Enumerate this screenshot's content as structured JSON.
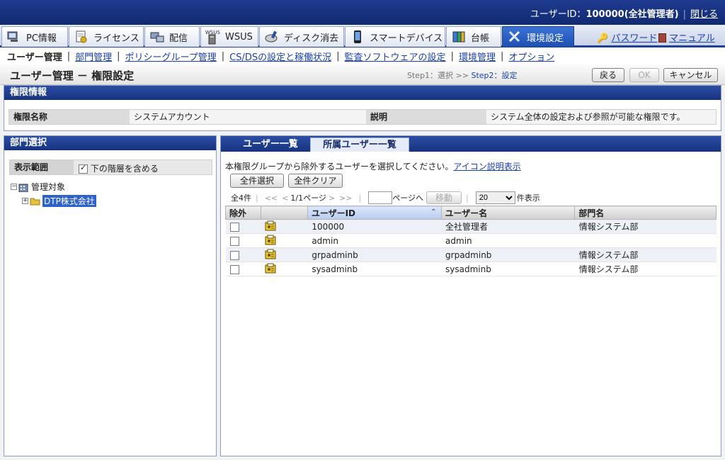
{
  "header": {
    "user_id_label": "ユーザーID：",
    "user_id_value": "100000(全社管理者)",
    "close_label": "閉じる"
  },
  "main_tabs": [
    {
      "label": "PC情報",
      "icon": "pc-icon"
    },
    {
      "label": "ライセンス",
      "icon": "license-icon"
    },
    {
      "label": "配信",
      "icon": "distribution-icon"
    },
    {
      "label": "WSUS",
      "icon": "wsus-icon"
    },
    {
      "label": "ディスク消去",
      "icon": "disk-erase-icon"
    },
    {
      "label": "スマートデバイス",
      "icon": "smart-device-icon"
    },
    {
      "label": "台帳",
      "icon": "ledger-icon"
    },
    {
      "label": "環境設定",
      "icon": "settings-tools-icon",
      "active": true
    }
  ],
  "right_links": {
    "password": "パスワード",
    "manual": "マニュアル"
  },
  "subnav": {
    "current": "ユーザー管理",
    "items": [
      "部門管理",
      "ポリシーグループ管理",
      "CS/DSの設定と稼働状況",
      "監査ソフトウェアの設定",
      "環境管理",
      "オプション"
    ]
  },
  "page": {
    "title": "ユーザー管理 － 権限設定",
    "step1": "Step1：選択 ",
    "step_arrow": ">>",
    "step2": " Step2：設定",
    "back_label": "戻る",
    "ok_label": "OK",
    "cancel_label": "キャンセル"
  },
  "authority": {
    "header": "権限情報",
    "name_label": "権限名称",
    "name_value": "システムアカウント",
    "desc_label": "説明",
    "desc_value": "システム全体の設定および参照が可能な権限です。"
  },
  "dept": {
    "header": "部門選択",
    "range_label": "表示範囲",
    "include_sub_label": "下の階層を含める",
    "include_sub_checked": true,
    "tree": {
      "root": "管理対象",
      "child": "DTP株式会社"
    }
  },
  "users": {
    "tab_list": "ユーザー一覧",
    "tab_members": "所属ユーザー一覧",
    "instruction": "本権限グループから除外するユーザーを選択してください。",
    "icon_legend_link": "アイコン説明表示",
    "select_all": "全件選択",
    "clear_all": "全件クリア",
    "pager": {
      "total": "全4件",
      "first": "<<",
      "prev": "<",
      "page_info": "1/1ページ",
      "next": ">",
      "last": ">>",
      "page_input": "",
      "goto_label": "ページへ",
      "move_label": "移動",
      "per_page": "20",
      "per_page_suffix": "件表示"
    },
    "columns": [
      "除外",
      "",
      "ユーザーID",
      "ユーザー名",
      "部門名"
    ],
    "rows": [
      {
        "id": "100000",
        "name": "全社管理者",
        "dept": "情報システム部"
      },
      {
        "id": "admin",
        "name": "admin",
        "dept": ""
      },
      {
        "id": "grpadminb",
        "name": "grpadminb",
        "dept": "情報システム部"
      },
      {
        "id": "sysadminb",
        "name": "sysadminb",
        "dept": "情報システム部"
      }
    ]
  }
}
